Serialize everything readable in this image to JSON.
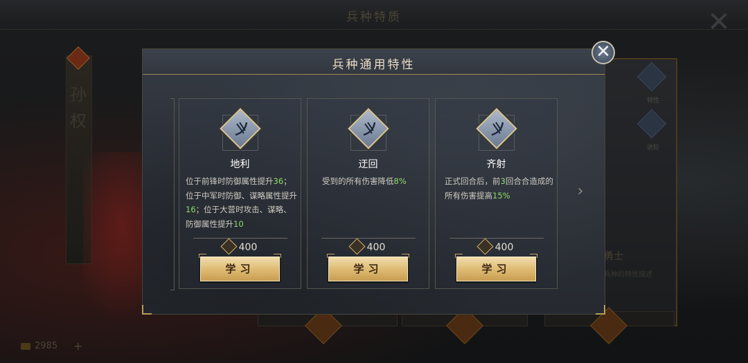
{
  "background": {
    "screen_title": "兵种特质",
    "hero_name": "孙权",
    "side_labels": [
      "特性",
      "进阶"
    ],
    "right_title": "勇士",
    "right_subtitle": "兵种的特性描述",
    "coins": "2985",
    "plus": "+",
    "close_glyph": "✕"
  },
  "modal": {
    "title": "兵种通用特性",
    "close_glyph": "✕",
    "next_glyph": "›"
  },
  "cards": [
    {
      "name": "地利",
      "desc": [
        {
          "t": "位于前锋时防御属性提升"
        },
        {
          "t": "36",
          "hl": true
        },
        {
          "t": "；位于中军时防御、谋略属性提升"
        },
        {
          "t": "16",
          "hl": true
        },
        {
          "t": "；位于大营时攻击、谋略、防御属性提升"
        },
        {
          "t": "10",
          "hl": true
        }
      ],
      "cost": "400",
      "button": "学习"
    },
    {
      "name": "迂回",
      "desc": [
        {
          "t": "受到的所有伤害降低"
        },
        {
          "t": "8%",
          "hl": true
        }
      ],
      "cost": "400",
      "button": "学习"
    },
    {
      "name": "齐射",
      "desc": [
        {
          "t": "正式回合后，前"
        },
        {
          "t": "3",
          "hl": true
        },
        {
          "t": "回合合造成的所有伤害提高"
        },
        {
          "t": "15%",
          "hl": true
        }
      ],
      "cost": "400",
      "button": "学习"
    }
  ],
  "colors": {
    "accent_gold": "#ddb96f",
    "highlight_green": "#8fdc6a"
  },
  "icons": {
    "card_icon": "bow-arrows-icon",
    "cost_icon": "currency-token-icon"
  }
}
